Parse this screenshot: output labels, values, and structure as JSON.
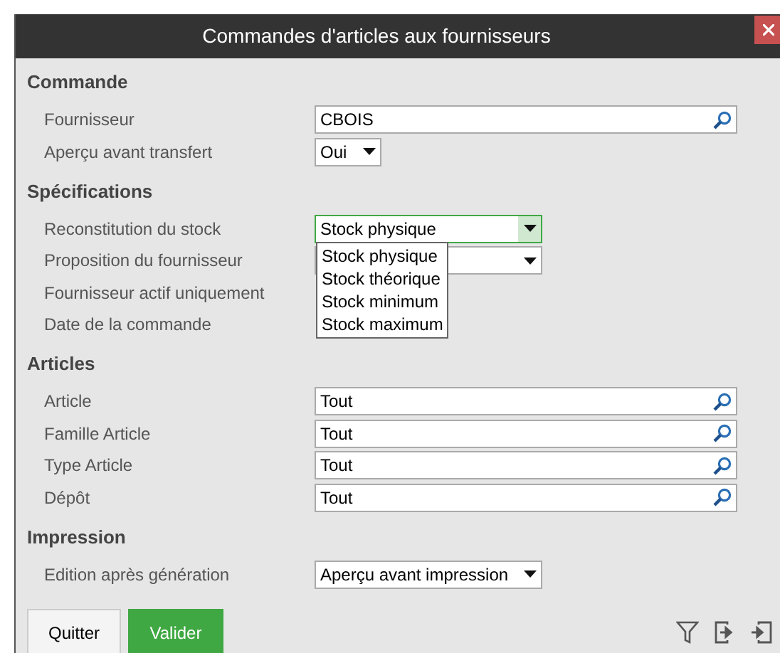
{
  "window": {
    "title": "Commandes d'articles aux fournisseurs"
  },
  "sections": [
    {
      "title": "Commande",
      "rows": [
        {
          "label": "Fournisseur",
          "kind": "search",
          "value": "CBOIS"
        },
        {
          "label": "Aperçu avant transfert",
          "kind": "short_select",
          "value": "Oui"
        }
      ]
    },
    {
      "title": "Spécifications",
      "rows": [
        {
          "label": "Reconstitution du stock",
          "kind": "select",
          "value": "Stock physique",
          "focused": true,
          "options": [
            "Stock physique",
            "Stock théorique",
            "Stock minimum",
            "Stock maximum"
          ]
        },
        {
          "label": "Proposition du fournisseur",
          "kind": "select"
        },
        {
          "label": "Fournisseur actif uniquement",
          "kind": "none"
        },
        {
          "label": "Date de la commande",
          "kind": "none"
        }
      ]
    },
    {
      "title": "Articles",
      "rows": [
        {
          "label": "Article",
          "kind": "search",
          "value": "Tout"
        },
        {
          "label": "Famille Article",
          "kind": "search",
          "value": "Tout"
        },
        {
          "label": "Type Article",
          "kind": "search",
          "value": "Tout"
        },
        {
          "label": "Dépôt",
          "kind": "search",
          "value": "Tout"
        }
      ]
    },
    {
      "title": "Impression",
      "rows": [
        {
          "label": "Edition après génération",
          "kind": "select",
          "value": "Aperçu avant impression"
        }
      ]
    }
  ],
  "buttons": [
    {
      "label": "Quitter",
      "kind": "secondary"
    },
    {
      "label": "Valider",
      "kind": "primary"
    }
  ]
}
